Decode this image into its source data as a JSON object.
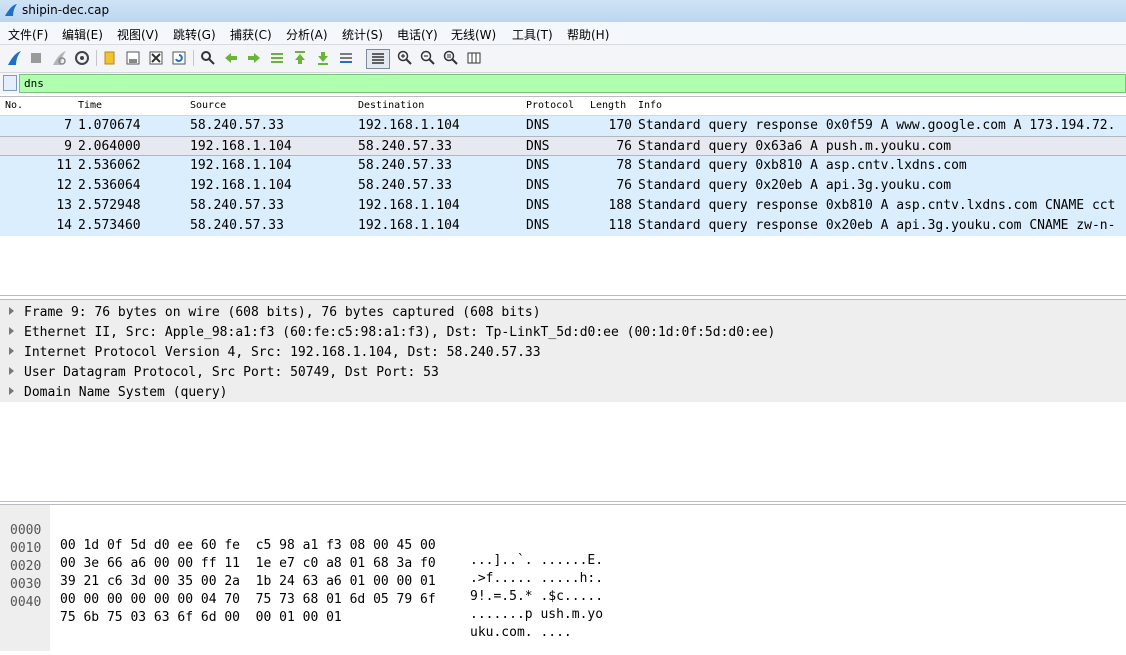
{
  "window": {
    "title": "shipin-dec.cap"
  },
  "menu": [
    "文件(F)",
    "编辑(E)",
    "视图(V)",
    "跳转(G)",
    "捕获(C)",
    "分析(A)",
    "统计(S)",
    "电话(Y)",
    "无线(W)",
    "工具(T)",
    "帮助(H)"
  ],
  "toolbar": {
    "icons": [
      "start-capture-icon",
      "stop-capture-icon",
      "restart-capture-icon",
      "capture-options-icon",
      "open-file-icon",
      "save-file-icon",
      "close-file-icon",
      "reload-file-icon",
      "find-packet-icon",
      "go-back-icon",
      "go-forward-icon",
      "go-to-packet-icon",
      "first-packet-icon",
      "last-packet-icon",
      "autoscroll-icon",
      "colorize-icon",
      "zoom-in-icon",
      "zoom-out-icon",
      "normal-size-icon",
      "resize-columns-icon"
    ]
  },
  "filter": {
    "value": "dns"
  },
  "packet_list": {
    "columns": [
      "No.",
      "Time",
      "Source",
      "Destination",
      "Protocol",
      "Length",
      "Info"
    ],
    "rows": [
      {
        "no": "7",
        "time": "1.070674",
        "src": "58.240.57.33",
        "dst": "192.168.1.104",
        "proto": "DNS",
        "len": "170",
        "info": "Standard query response 0x0f59 A www.google.com A 173.194.72.",
        "selected": false
      },
      {
        "no": "9",
        "time": "2.064000",
        "src": "192.168.1.104",
        "dst": "58.240.57.33",
        "proto": "DNS",
        "len": "76",
        "info": "Standard query 0x63a6 A push.m.youku.com",
        "selected": true
      },
      {
        "no": "11",
        "time": "2.536062",
        "src": "192.168.1.104",
        "dst": "58.240.57.33",
        "proto": "DNS",
        "len": "78",
        "info": "Standard query 0xb810 A asp.cntv.lxdns.com",
        "selected": false
      },
      {
        "no": "12",
        "time": "2.536064",
        "src": "192.168.1.104",
        "dst": "58.240.57.33",
        "proto": "DNS",
        "len": "76",
        "info": "Standard query 0x20eb A api.3g.youku.com",
        "selected": false
      },
      {
        "no": "13",
        "time": "2.572948",
        "src": "58.240.57.33",
        "dst": "192.168.1.104",
        "proto": "DNS",
        "len": "188",
        "info": "Standard query response 0xb810 A asp.cntv.lxdns.com CNAME cct",
        "selected": false
      },
      {
        "no": "14",
        "time": "2.573460",
        "src": "58.240.57.33",
        "dst": "192.168.1.104",
        "proto": "DNS",
        "len": "118",
        "info": "Standard query response 0x20eb A api.3g.youku.com CNAME zw-n-",
        "selected": false
      }
    ]
  },
  "details": [
    "Frame 9: 76 bytes on wire (608 bits), 76 bytes captured (608 bits)",
    "Ethernet II, Src: Apple_98:a1:f3 (60:fe:c5:98:a1:f3), Dst: Tp-LinkT_5d:d0:ee (00:1d:0f:5d:d0:ee)",
    "Internet Protocol Version 4, Src: 192.168.1.104, Dst: 58.240.57.33",
    "User Datagram Protocol, Src Port: 50749, Dst Port: 53",
    "Domain Name System (query)"
  ],
  "bytes": [
    {
      "offset": "0000",
      "hex": "00 1d 0f 5d d0 ee 60 fe  c5 98 a1 f3 08 00 45 00",
      "ascii": "...]..`. ......E."
    },
    {
      "offset": "0010",
      "hex": "00 3e 66 a6 00 00 ff 11  1e e7 c0 a8 01 68 3a f0",
      "ascii": ".>f..... .....h:."
    },
    {
      "offset": "0020",
      "hex": "39 21 c6 3d 00 35 00 2a  1b 24 63 a6 01 00 00 01",
      "ascii": "9!.=.5.* .$c....."
    },
    {
      "offset": "0030",
      "hex": "00 00 00 00 00 00 04 70  75 73 68 01 6d 05 79 6f",
      "ascii": ".......p ush.m.yo"
    },
    {
      "offset": "0040",
      "hex": "75 6b 75 03 63 6f 6d 00  00 01 00 01",
      "ascii": "uku.com. ...."
    }
  ]
}
